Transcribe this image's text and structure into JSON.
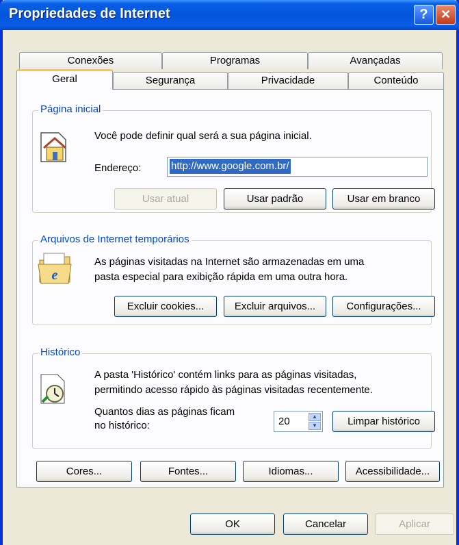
{
  "window": {
    "title": "Propriedades de Internet",
    "help_glyph": "?",
    "close_glyph": "✕"
  },
  "tabs_back": [
    "Conexões",
    "Programas",
    "Avançadas"
  ],
  "tabs_front": [
    "Geral",
    "Segurança",
    "Privacidade",
    "Conteúdo"
  ],
  "active_tab": "Geral",
  "home": {
    "group_label": "Página inicial",
    "description": "Você pode definir qual será a sua página inicial.",
    "address_label": "Endereço:",
    "address_value": "http://www.google.com.br/",
    "btn_current": "Usar atual",
    "btn_default": "Usar padrão",
    "btn_blank": "Usar em branco"
  },
  "temp": {
    "group_label": "Arquivos de Internet temporários",
    "line1": "As páginas visitadas na Internet são armazenadas em uma",
    "line2": "pasta especial para exibição rápida em uma outra hora.",
    "btn_cookies": "Excluir cookies...",
    "btn_files": "Excluir arquivos...",
    "btn_settings": "Configurações..."
  },
  "history": {
    "group_label": "Histórico",
    "line1": "A pasta 'Histórico' contém links para as páginas visitadas,",
    "line2": "permitindo acesso rápido às páginas visitadas recentemente.",
    "days_label1": "Quantos dias as páginas ficam",
    "days_label2": "no histórico:",
    "days_value": "20",
    "btn_clear": "Limpar histórico"
  },
  "extra_buttons": {
    "colors": "Cores...",
    "fonts": "Fontes...",
    "languages": "Idiomas...",
    "accessibility": "Acessibilidade..."
  },
  "dialog_buttons": {
    "ok": "OK",
    "cancel": "Cancelar",
    "apply": "Aplicar"
  }
}
